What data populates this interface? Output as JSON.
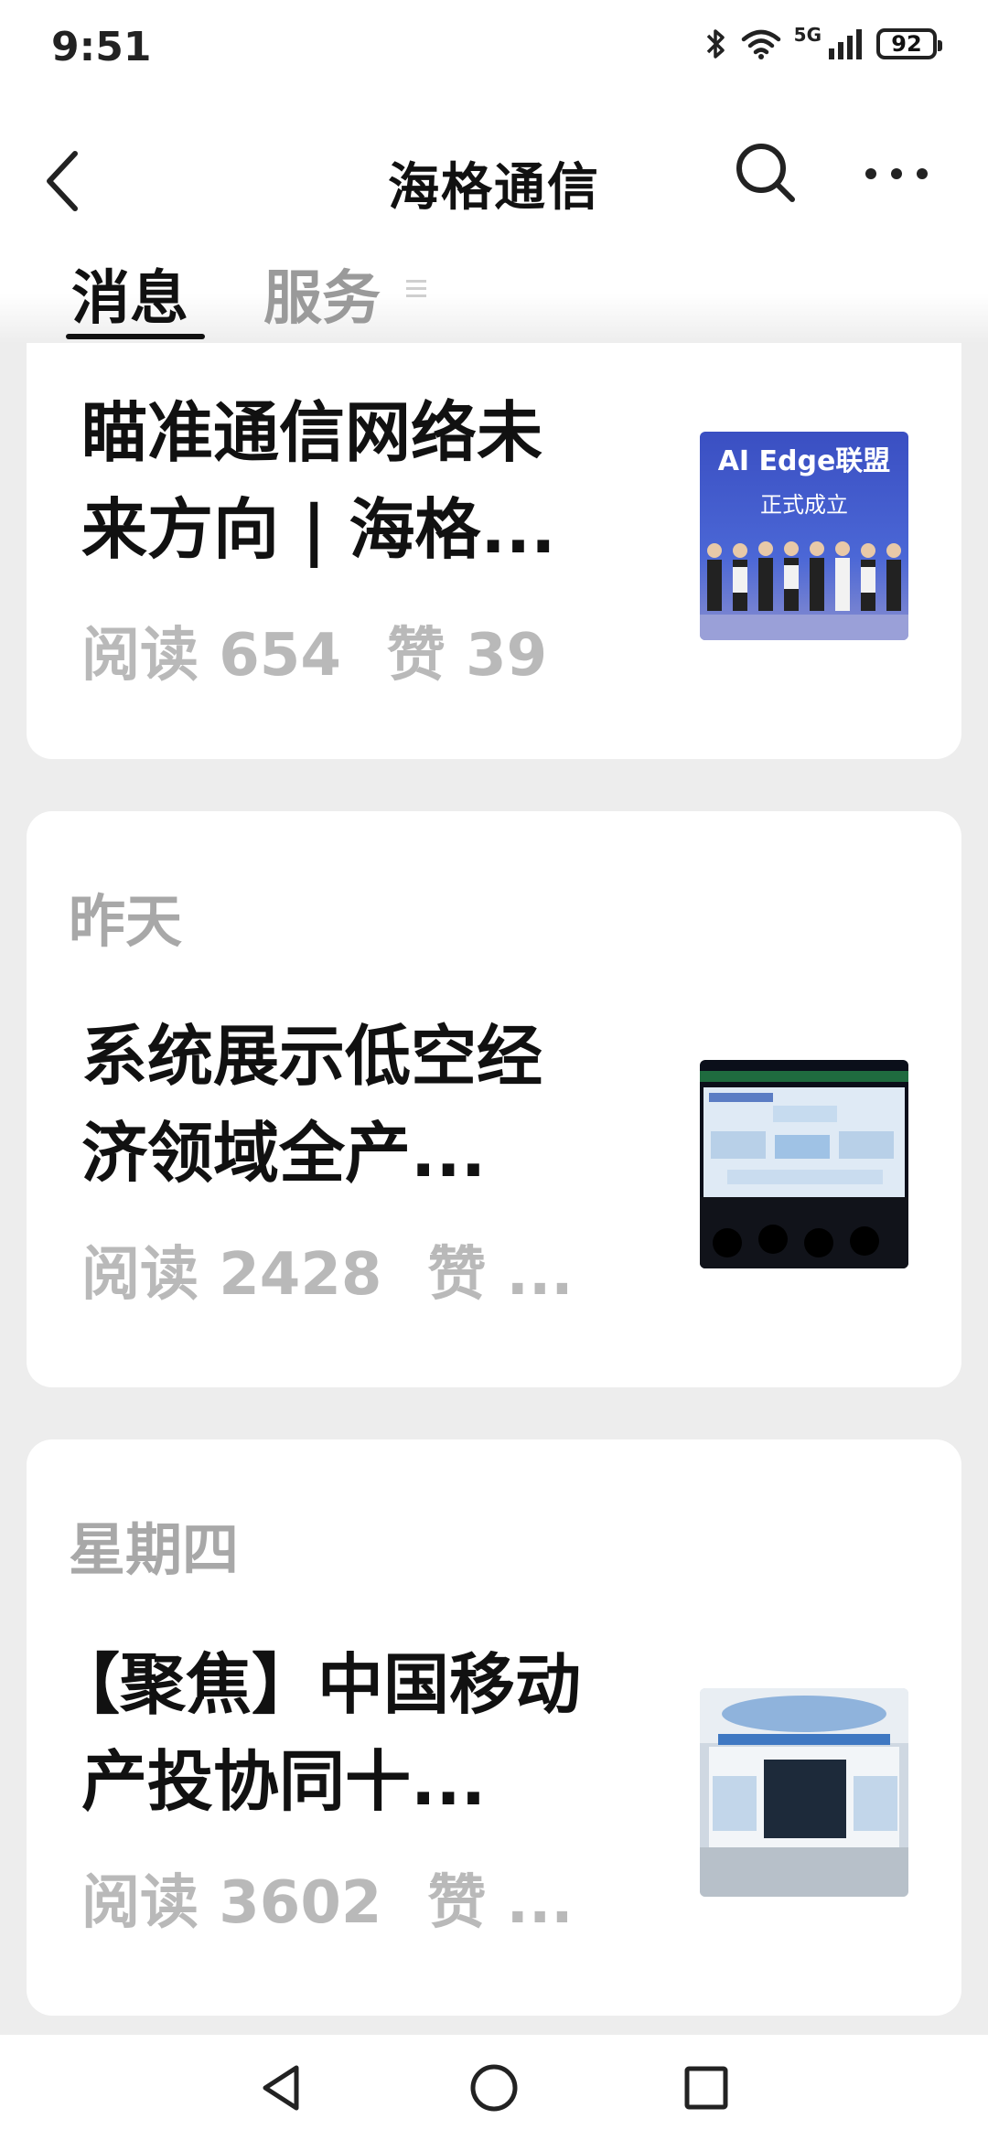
{
  "status": {
    "time": "9:51",
    "network": "5G",
    "battery": "92"
  },
  "header": {
    "title": "海格通信"
  },
  "tabs": [
    {
      "label": "消息"
    },
    {
      "label": "服务"
    }
  ],
  "articles": [
    {
      "date": "",
      "title_line1": "瞄准通信网络未",
      "title_line2": "来方向 | 海格...",
      "reads": "阅读 654",
      "likes": "赞 39",
      "thumb_text_line1": "AI Edge联盟",
      "thumb_text_line2": "正式成立"
    },
    {
      "date": "昨天",
      "title_line1": "系统展示低空经",
      "title_line2": "济领域全产...",
      "reads": "阅读 2428",
      "likes": "赞 ..."
    },
    {
      "date": "星期四",
      "title_line1": "【聚焦】中国移动",
      "title_line2": "产投协同十...",
      "reads": "阅读 3602",
      "likes": "赞 ..."
    }
  ]
}
